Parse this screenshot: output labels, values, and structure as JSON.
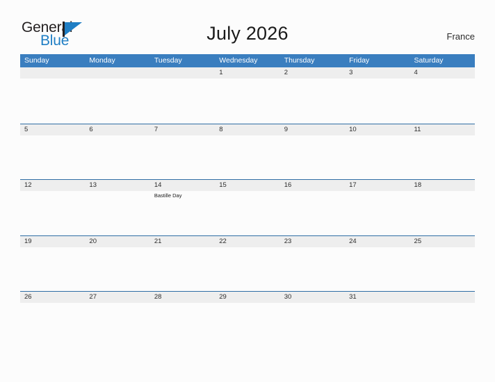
{
  "brand": {
    "name_part1": "General",
    "name_part2": "Blue",
    "flag_icon": "flag-triangle-icon",
    "accent_color": "#1f7ec4"
  },
  "header": {
    "title": "July 2026",
    "country": "France"
  },
  "colors": {
    "header_blue": "#3a7ebf",
    "row_divider_blue": "#2e6da4",
    "date_band_gray": "#eeeeee",
    "page_background": "#fcfcfc",
    "text_dark": "#2b2b2b"
  },
  "calendar": {
    "month": "July",
    "year": "2026",
    "weekday_headers": [
      "Sunday",
      "Monday",
      "Tuesday",
      "Wednesday",
      "Thursday",
      "Friday",
      "Saturday"
    ],
    "weeks": [
      {
        "days": [
          {
            "num": "",
            "events": []
          },
          {
            "num": "",
            "events": []
          },
          {
            "num": "",
            "events": []
          },
          {
            "num": "1",
            "events": []
          },
          {
            "num": "2",
            "events": []
          },
          {
            "num": "3",
            "events": []
          },
          {
            "num": "4",
            "events": []
          }
        ]
      },
      {
        "days": [
          {
            "num": "5",
            "events": []
          },
          {
            "num": "6",
            "events": []
          },
          {
            "num": "7",
            "events": []
          },
          {
            "num": "8",
            "events": []
          },
          {
            "num": "9",
            "events": []
          },
          {
            "num": "10",
            "events": []
          },
          {
            "num": "11",
            "events": []
          }
        ]
      },
      {
        "days": [
          {
            "num": "12",
            "events": []
          },
          {
            "num": "13",
            "events": []
          },
          {
            "num": "14",
            "events": [
              "Bastille Day"
            ]
          },
          {
            "num": "15",
            "events": []
          },
          {
            "num": "16",
            "events": []
          },
          {
            "num": "17",
            "events": []
          },
          {
            "num": "18",
            "events": []
          }
        ]
      },
      {
        "days": [
          {
            "num": "19",
            "events": []
          },
          {
            "num": "20",
            "events": []
          },
          {
            "num": "21",
            "events": []
          },
          {
            "num": "22",
            "events": []
          },
          {
            "num": "23",
            "events": []
          },
          {
            "num": "24",
            "events": []
          },
          {
            "num": "25",
            "events": []
          }
        ]
      },
      {
        "days": [
          {
            "num": "26",
            "events": []
          },
          {
            "num": "27",
            "events": []
          },
          {
            "num": "28",
            "events": []
          },
          {
            "num": "29",
            "events": []
          },
          {
            "num": "30",
            "events": []
          },
          {
            "num": "31",
            "events": []
          },
          {
            "num": "",
            "events": []
          }
        ]
      }
    ]
  }
}
